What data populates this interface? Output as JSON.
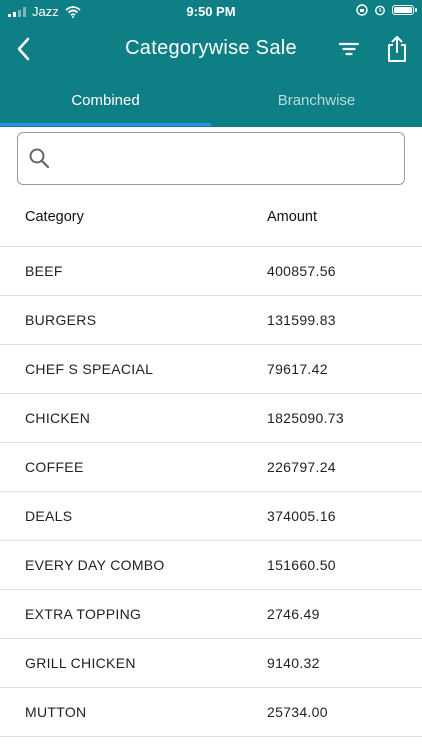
{
  "status": {
    "carrier": "Jazz",
    "time": "9:50 PM"
  },
  "header": {
    "title": "Categorywise Sale"
  },
  "tabs": [
    {
      "label": "Combined"
    },
    {
      "label": "Branchwise"
    }
  ],
  "search": {
    "placeholder": ""
  },
  "table": {
    "headers": {
      "category": "Category",
      "amount": "Amount"
    },
    "rows": [
      {
        "category": "BEEF",
        "amount": "400857.56"
      },
      {
        "category": "BURGERS",
        "amount": "131599.83"
      },
      {
        "category": "CHEF S SPEACIAL",
        "amount": "79617.42"
      },
      {
        "category": "CHICKEN",
        "amount": "1825090.73"
      },
      {
        "category": "COFFEE",
        "amount": "226797.24"
      },
      {
        "category": "DEALS",
        "amount": "374005.16"
      },
      {
        "category": "EVERY DAY COMBO",
        "amount": "151660.50"
      },
      {
        "category": "EXTRA TOPPING",
        "amount": "2746.49"
      },
      {
        "category": "GRILL CHICKEN",
        "amount": "9140.32"
      },
      {
        "category": "MUTTON",
        "amount": "25734.00"
      }
    ]
  },
  "colors": {
    "header_bg": "#0e7f85",
    "tab_indicator": "#2f8fe0"
  }
}
